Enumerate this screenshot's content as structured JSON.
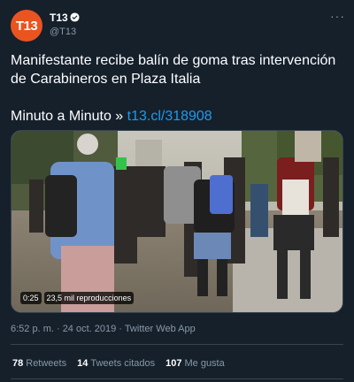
{
  "author": {
    "avatar_text": "T13",
    "name": "T13",
    "handle": "@T13",
    "verified": true,
    "avatar_color": "#ea5420"
  },
  "more_icon": "more-icon",
  "tweet": {
    "text": "Manifestante recibe balín de goma tras intervención de Carabineros en Plaza Italia",
    "cta_prefix": "Minuto a Minuto » ",
    "link": "t13.cl/318908"
  },
  "media": {
    "duration": "0:25",
    "views": "23,5 mil reproducciones"
  },
  "meta": {
    "timestamp": "6:52 p. m. · 24 oct. 2019 · Twitter Web App"
  },
  "stats": {
    "retweets_count": "78",
    "retweets_label": "Retweets",
    "quotes_count": "14",
    "quotes_label": "Tweets citados",
    "likes_count": "107",
    "likes_label": "Me gusta"
  },
  "colors": {
    "background": "#15202b",
    "secondary_text": "#8899a6",
    "link": "#1d9bf0",
    "divider": "#38444d"
  }
}
